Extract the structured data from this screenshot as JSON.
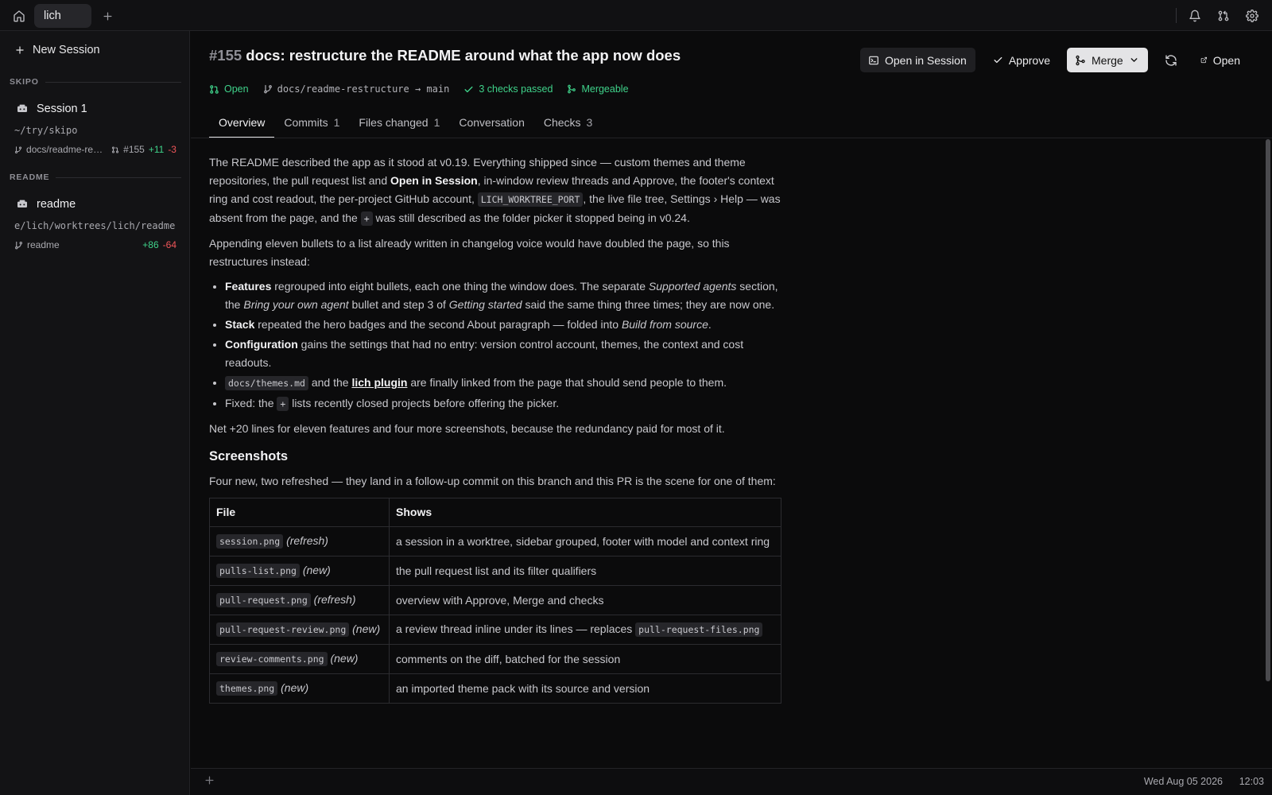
{
  "topbar": {
    "tab_label": "lich"
  },
  "sidebar": {
    "new_session": "New Session",
    "groups": [
      {
        "name": "SKIPO",
        "session": "Session 1",
        "path": "~/try/skipo",
        "branch": "docs/readme-re…",
        "pr": "#155",
        "additions": "+11",
        "deletions": "-3"
      },
      {
        "name": "README",
        "session": "readme",
        "path": "e/lich/worktrees/lich/readme",
        "branch": "readme",
        "additions": "+86",
        "deletions": "-64"
      }
    ]
  },
  "header": {
    "pr_number": "#155",
    "title": "docs: restructure the README around what the app now does",
    "state": "Open",
    "branches": "docs/readme-restructure → main",
    "checks": "3 checks passed",
    "mergeable": "Mergeable",
    "buttons": {
      "open_in_session": "Open in Session",
      "approve": "Approve",
      "merge": "Merge",
      "open": "Open"
    }
  },
  "tabs": [
    {
      "label": "Overview",
      "count": ""
    },
    {
      "label": "Commits",
      "count": "1"
    },
    {
      "label": "Files changed",
      "count": "1"
    },
    {
      "label": "Conversation",
      "count": ""
    },
    {
      "label": "Checks",
      "count": "3"
    }
  ],
  "body": {
    "p1": {
      "a": "The README described the app as it stood at v0.19. Everything shipped since — custom themes and theme repositories, the pull request list and ",
      "b": "Open in Session",
      "c": ", in-window review threads and Approve, the footer's context ring and cost readout, the per-project GitHub account, ",
      "code": "LICH_WORKTREE_PORT",
      "d": ", the live file tree, Settings › Help — was absent from the page, and the ",
      "code2": "+",
      "e": " was still described as the folder picker it stopped being in v0.24."
    },
    "p2": "Appending eleven bullets to a list already written in changelog voice would have doubled the page, so this restructures instead:",
    "bullets": {
      "b1": {
        "bold": "Features",
        "t1": " regrouped into eight bullets, each one thing the window does. The separate ",
        "i1": "Supported agents",
        "t2": " section, the ",
        "i2": "Bring your own agent",
        "t3": " bullet and step 3 of ",
        "i3": "Getting started",
        "t4": " said the same thing three times; they are now one."
      },
      "b2": {
        "bold": "Stack",
        "t1": " repeated the hero badges and the second About paragraph — folded into ",
        "i1": "Build from source",
        "t2": "."
      },
      "b3": {
        "bold": "Configuration",
        "t1": " gains the settings that had no entry: version control account, themes, the context and cost readouts."
      },
      "b4": {
        "code": "docs/themes.md",
        "t1": " and the ",
        "link": "lich plugin",
        "t2": " are finally linked from the page that should send people to them."
      },
      "b5": {
        "t1": "Fixed: the ",
        "code": "+",
        "t2": " lists recently closed projects before offering the picker."
      }
    },
    "p3": "Net +20 lines for eleven features and four more screenshots, because the redundancy paid for most of it.",
    "screenshots_heading": "Screenshots",
    "p4": "Four new, two refreshed — they land in a follow-up commit on this branch and this PR is the scene for one of them:",
    "table": {
      "headers": [
        "File",
        "Shows"
      ],
      "rows": [
        {
          "file": "session.png",
          "tag": "(refresh)",
          "shows": "a session in a worktree, sidebar grouped, footer with model and context ring",
          "code": ""
        },
        {
          "file": "pulls-list.png",
          "tag": "(new)",
          "shows": "the pull request list and its filter qualifiers",
          "code": ""
        },
        {
          "file": "pull-request.png",
          "tag": "(refresh)",
          "shows": "overview with Approve, Merge and checks",
          "code": ""
        },
        {
          "file": "pull-request-review.png",
          "tag": "(new)",
          "shows": "a review thread inline under its lines — replaces ",
          "code": "pull-request-files.png"
        },
        {
          "file": "review-comments.png",
          "tag": "(new)",
          "shows": "comments on the diff, batched for the session",
          "code": ""
        },
        {
          "file": "themes.png",
          "tag": "(new)",
          "shows": "an imported theme pack with its source and version",
          "code": ""
        }
      ]
    }
  },
  "footer": {
    "date": "Wed Aug 05 2026",
    "time": "12:03"
  },
  "colors": {
    "background": "#0b0b0c",
    "sidebar": "#131315",
    "accent_green": "#3fd28a",
    "deletion_red": "#f0565a",
    "merge_button": "#e4e4e6"
  },
  "icons": [
    "home-icon",
    "plus-icon",
    "bell-icon",
    "git-pull-request-icon",
    "gear-icon",
    "terminal-icon",
    "check-icon",
    "git-merge-icon",
    "chevron-down-icon",
    "refresh-icon",
    "external-link-icon",
    "git-branch-icon",
    "agent-icon"
  ]
}
